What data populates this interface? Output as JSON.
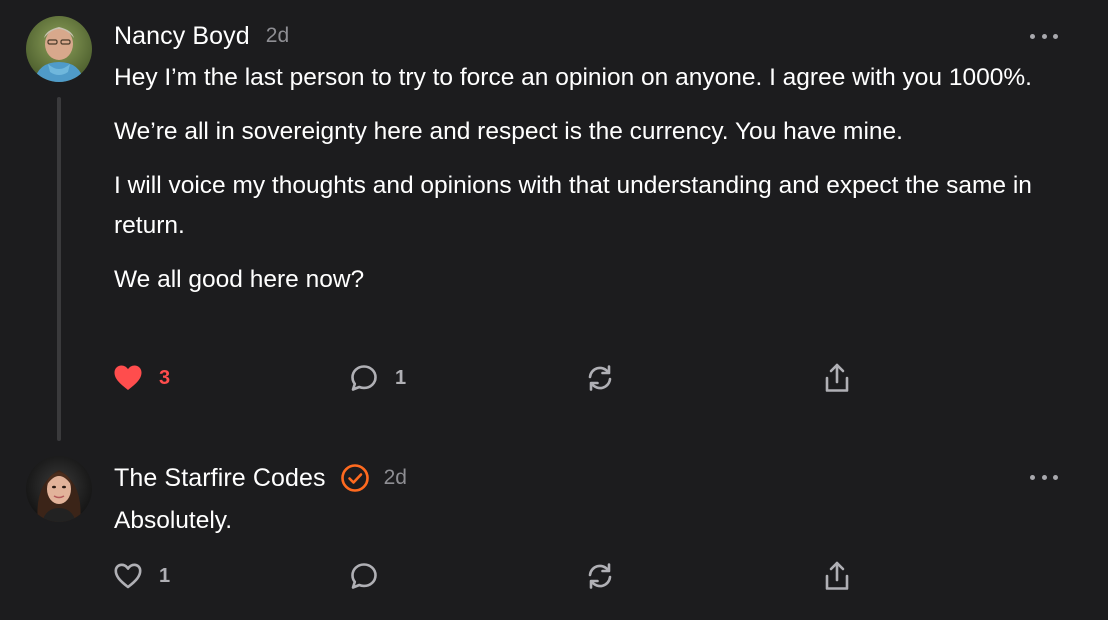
{
  "comments": [
    {
      "author": "Nancy Boyd",
      "time": "2d",
      "verified": false,
      "paragraphs": [
        "Hey I’m the last person to try to force an opinion on anyone. I agree with you 1000%.",
        "We’re all in sovereignty here and respect is the currency. You have mine.",
        "I will voice my thoughts and opinions with that understanding and expect the same in return.",
        "We all good here now?"
      ],
      "likes": "3",
      "liked": true,
      "replies": "1"
    },
    {
      "author": "The Starfire Codes",
      "time": "2d",
      "verified": true,
      "paragraphs": [
        "Absolutely."
      ],
      "likes": "1",
      "liked": false,
      "replies": ""
    }
  ],
  "colors": {
    "background": "#1c1c1e",
    "like_active": "#ff4d4d",
    "verified_badge": "#ff6a1f",
    "icon_muted": "#b0b0b5",
    "timestamp": "#8e8e93"
  },
  "icons": {
    "like": "heart-icon",
    "reply": "speech-bubble-icon",
    "restack": "restack-arrows-icon",
    "share": "share-upload-icon",
    "more": "ellipsis-icon",
    "verified": "check-badge-icon"
  }
}
